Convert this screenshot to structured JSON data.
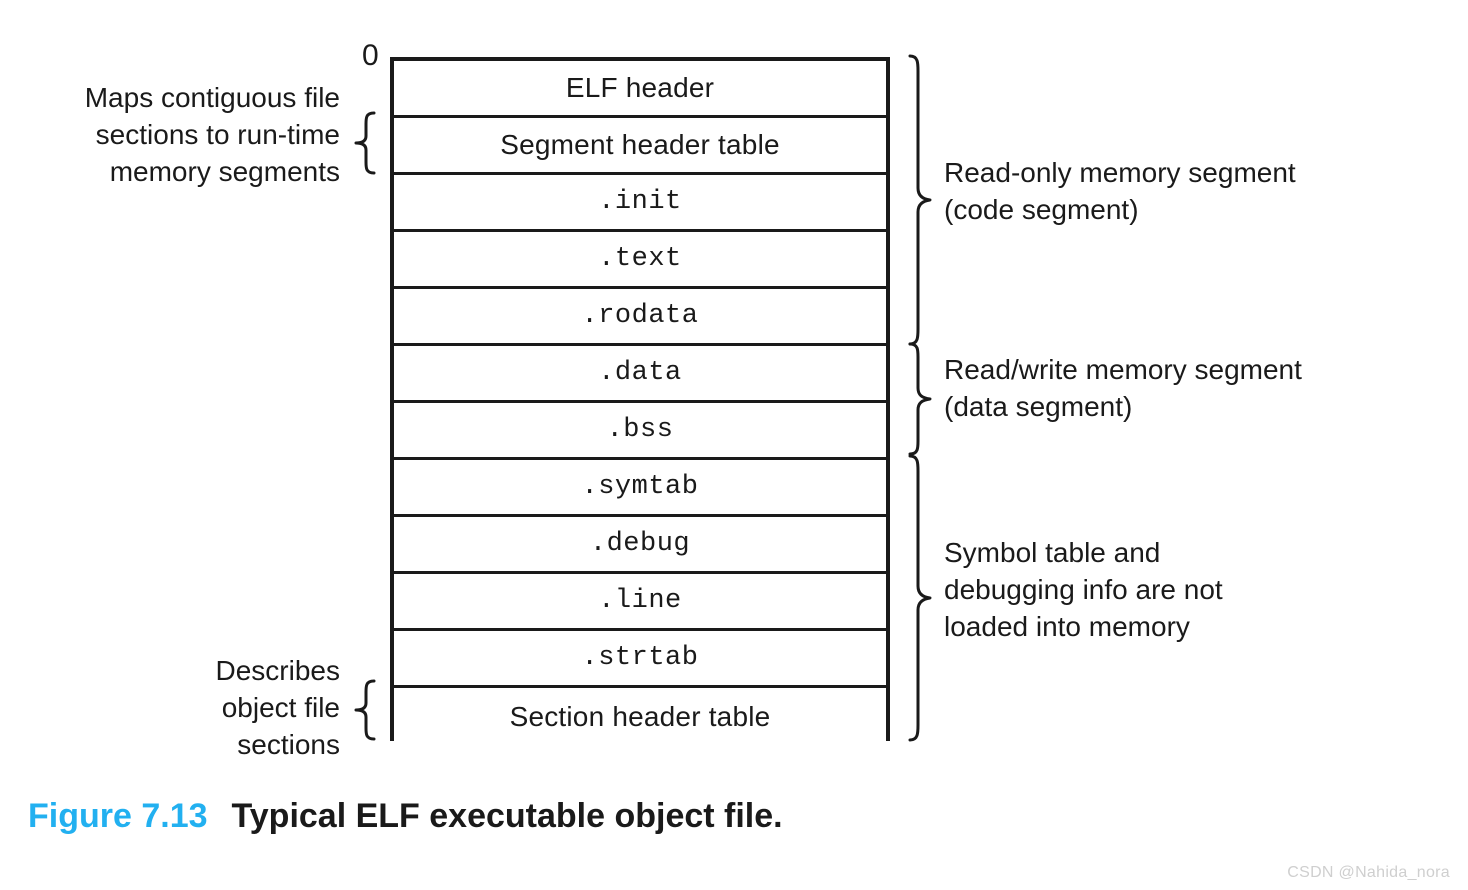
{
  "figure": {
    "number": "Figure 7.13",
    "title": "Typical ELF executable object file.",
    "number_color": "#22b0f0",
    "text_color": "#1a1a1a"
  },
  "diagram": {
    "origin_label": "0",
    "rows": [
      {
        "label": "ELF header",
        "style": "sans"
      },
      {
        "label": "Segment header table",
        "style": "sans"
      },
      {
        "label": ".init",
        "style": "mono"
      },
      {
        "label": ".text",
        "style": "mono"
      },
      {
        "label": ".rodata",
        "style": "mono"
      },
      {
        "label": ".data",
        "style": "mono"
      },
      {
        "label": ".bss",
        "style": "mono"
      },
      {
        "label": ".symtab",
        "style": "mono"
      },
      {
        "label": ".debug",
        "style": "mono"
      },
      {
        "label": ".line",
        "style": "mono"
      },
      {
        "label": ".strtab",
        "style": "mono"
      },
      {
        "label": "Section header table",
        "style": "sans"
      }
    ]
  },
  "annotations": {
    "left": [
      {
        "id": "maps-contiguous",
        "lines": [
          "Maps contiguous file",
          "sections to run-time",
          "memory segments"
        ],
        "spans_rows": [
          "Segment header table"
        ]
      },
      {
        "id": "describes-object-file-sections",
        "lines": [
          "Describes",
          "object file",
          "sections"
        ],
        "spans_rows": [
          "Section header table"
        ]
      }
    ],
    "right": [
      {
        "id": "read-only-memory-segment",
        "lines": [
          "Read-only memory segment",
          "(code segment)"
        ],
        "spans_rows": [
          "ELF header",
          "Segment header table",
          ".init",
          ".text",
          ".rodata"
        ]
      },
      {
        "id": "read-write-memory-segment",
        "lines": [
          "Read/write memory segment",
          "(data segment)"
        ],
        "spans_rows": [
          ".data",
          ".bss"
        ]
      },
      {
        "id": "symbol-table-debug-info",
        "lines": [
          "Symbol table and",
          "debugging info are not",
          "loaded into memory"
        ],
        "spans_rows": [
          ".symtab",
          ".debug",
          ".line",
          ".strtab",
          "Section header table"
        ]
      }
    ]
  },
  "watermark": {
    "text": "CSDN @Nahida_nora"
  }
}
